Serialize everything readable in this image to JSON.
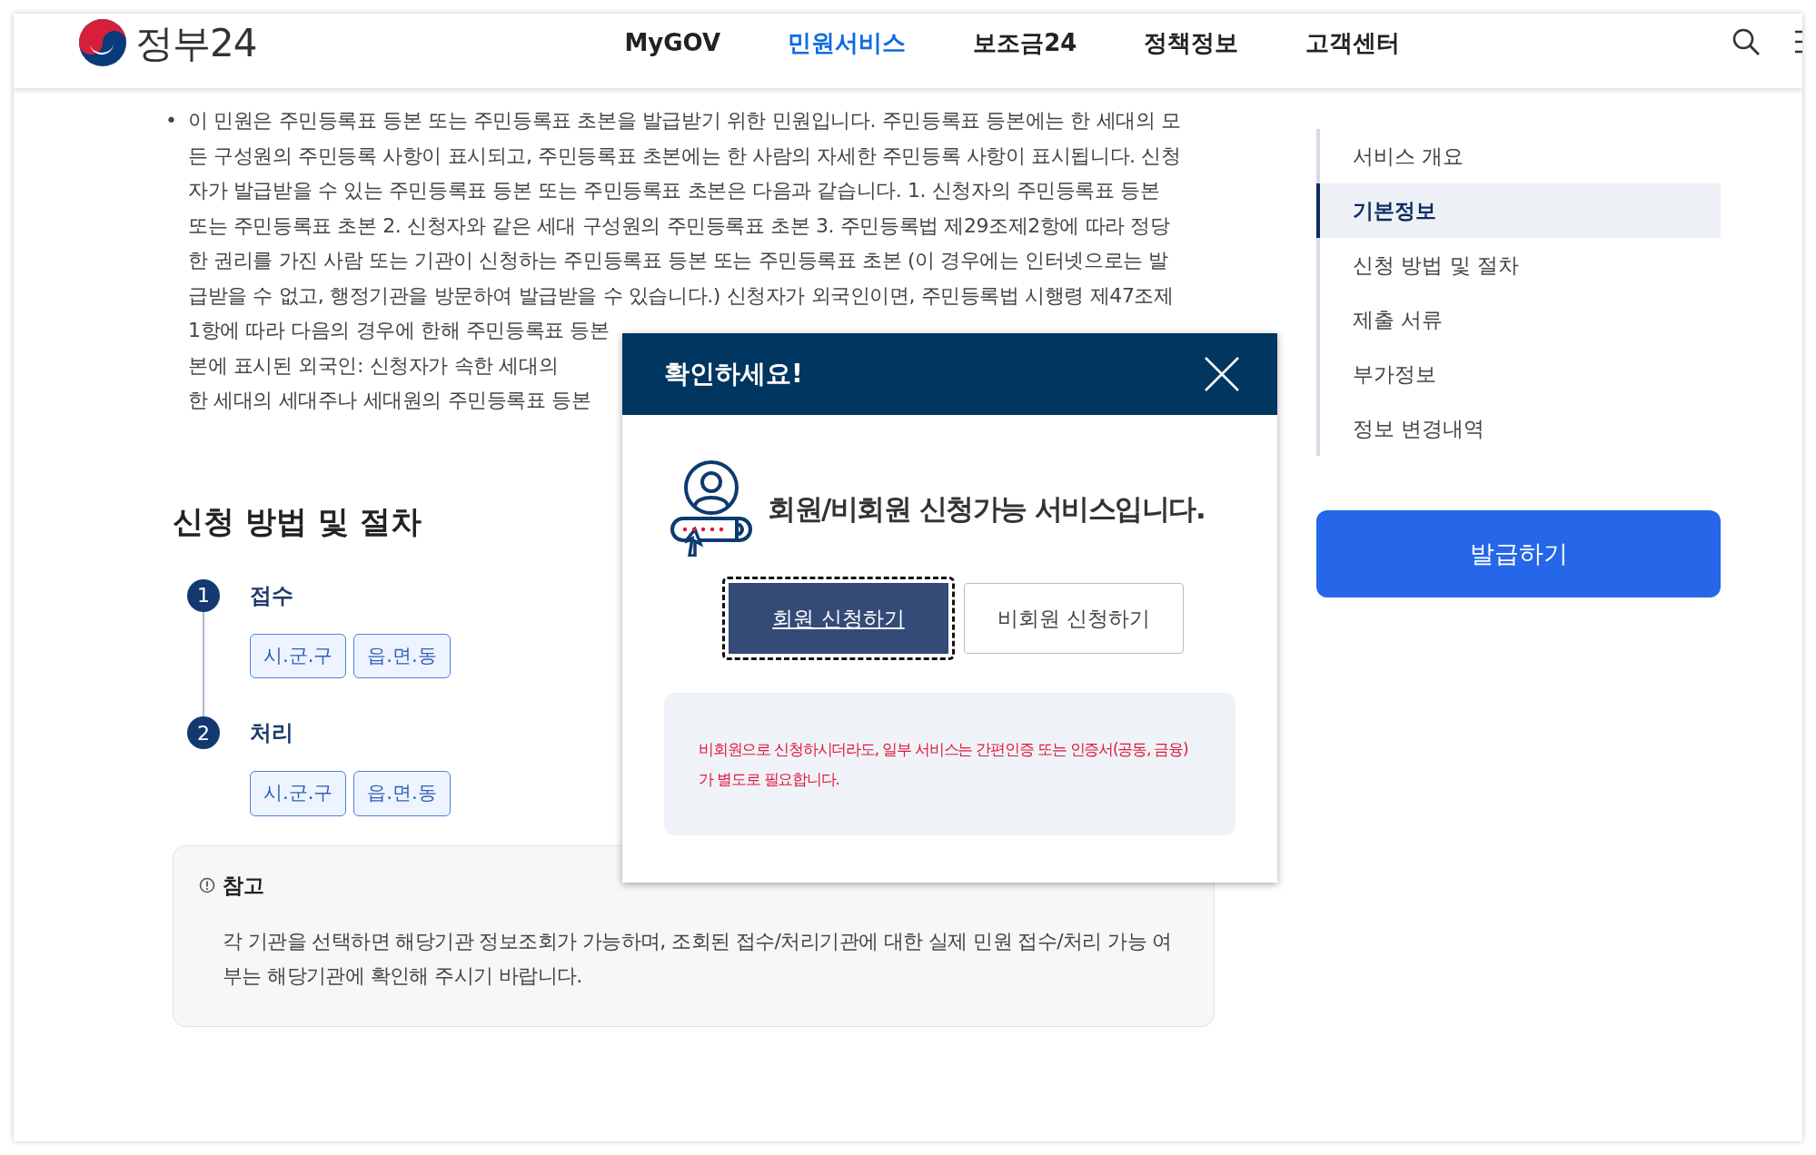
{
  "header": {
    "logo_text": "정부24",
    "nav": [
      {
        "label": "MyGOV",
        "selected": false
      },
      {
        "label": "민원서비스",
        "selected": true
      },
      {
        "label": "보조금24",
        "selected": false
      },
      {
        "label": "정책정보",
        "selected": false
      },
      {
        "label": "고객센터",
        "selected": false
      }
    ]
  },
  "content": {
    "bullet": "•",
    "description_lines": [
      "이 민원은 주민등록표 등본 또는 주민등록표 초본을 발급받기 위한 민원입니다. 주민등록표 등본에는 한 세대의 모",
      "든 구성원의 주민등록 사항이 표시되고, 주민등록표 초본에는 한 사람의 자세한 주민등록 사항이 표시됩니다. 신청",
      "자가 발급받을 수 있는 주민등록표 등본 또는 주민등록표 초본은 다음과 같습니다. 1. 신청자의 주민등록표 등본",
      "또는 주민등록표 초본 2. 신청자와 같은 세대 구성원의 주민등록표 초본 3. 주민등록법 제29조제2항에 따라 정당",
      "한 권리를 가진 사람 또는 기관이 신청하는 주민등록표 등본 또는 주민등록표 초본 (이 경우에는 인터넷으로는 발",
      "급받을 수 없고, 행정기관을 방문하여 발급받을 수 있습니다.) 신청자가 외국인이면, 주민등록법 시행령 제47조제",
      "1항에 따라 다음의 경우에 한해 주민등록표 등본",
      "본에 표시된 외국인: 신청자가 속한 세대의",
      "한 세대의 세대주나 세대원의 주민등록표 등본"
    ],
    "section_title": "신청 방법 및 절차",
    "steps": [
      {
        "number": "1",
        "label": "접수",
        "tags": [
          "시.군.구",
          "읍.면.동"
        ]
      },
      {
        "number": "2",
        "label": "처리",
        "tags": [
          "시.군.구",
          "읍.면.동"
        ]
      }
    ],
    "note": {
      "title": "참고",
      "text": "각 기관을 선택하면 해당기관 정보조회가 가능하며, 조회된 접수/처리기관에 대한 실제 민원 접수/처리 가능 여부는 해당기관에 확인해 주시기 바랍니다."
    }
  },
  "sidebar": {
    "items": [
      {
        "label": "서비스 개요",
        "selected": false
      },
      {
        "label": "기본정보",
        "selected": true
      },
      {
        "label": "신청 방법 및 절차",
        "selected": false
      },
      {
        "label": "제출 서류",
        "selected": false
      },
      {
        "label": "부가정보",
        "selected": false
      },
      {
        "label": "정보 변경내역",
        "selected": false
      }
    ],
    "issue_button": "발급하기"
  },
  "modal": {
    "title": "확인하세요!",
    "message": "회원/비회원 신청가능 서비스입니다.",
    "buttons": [
      {
        "label": "회원 신청하기",
        "kind": "primary",
        "focused": true
      },
      {
        "label": "비회원 신청하기",
        "kind": "secondary",
        "focused": false
      }
    ],
    "notice": "비회원으로 신청하시더라도, 일부 서비스는 간편인증 또는 인증서(공동, 금융)가 별도로 필요합니다."
  }
}
